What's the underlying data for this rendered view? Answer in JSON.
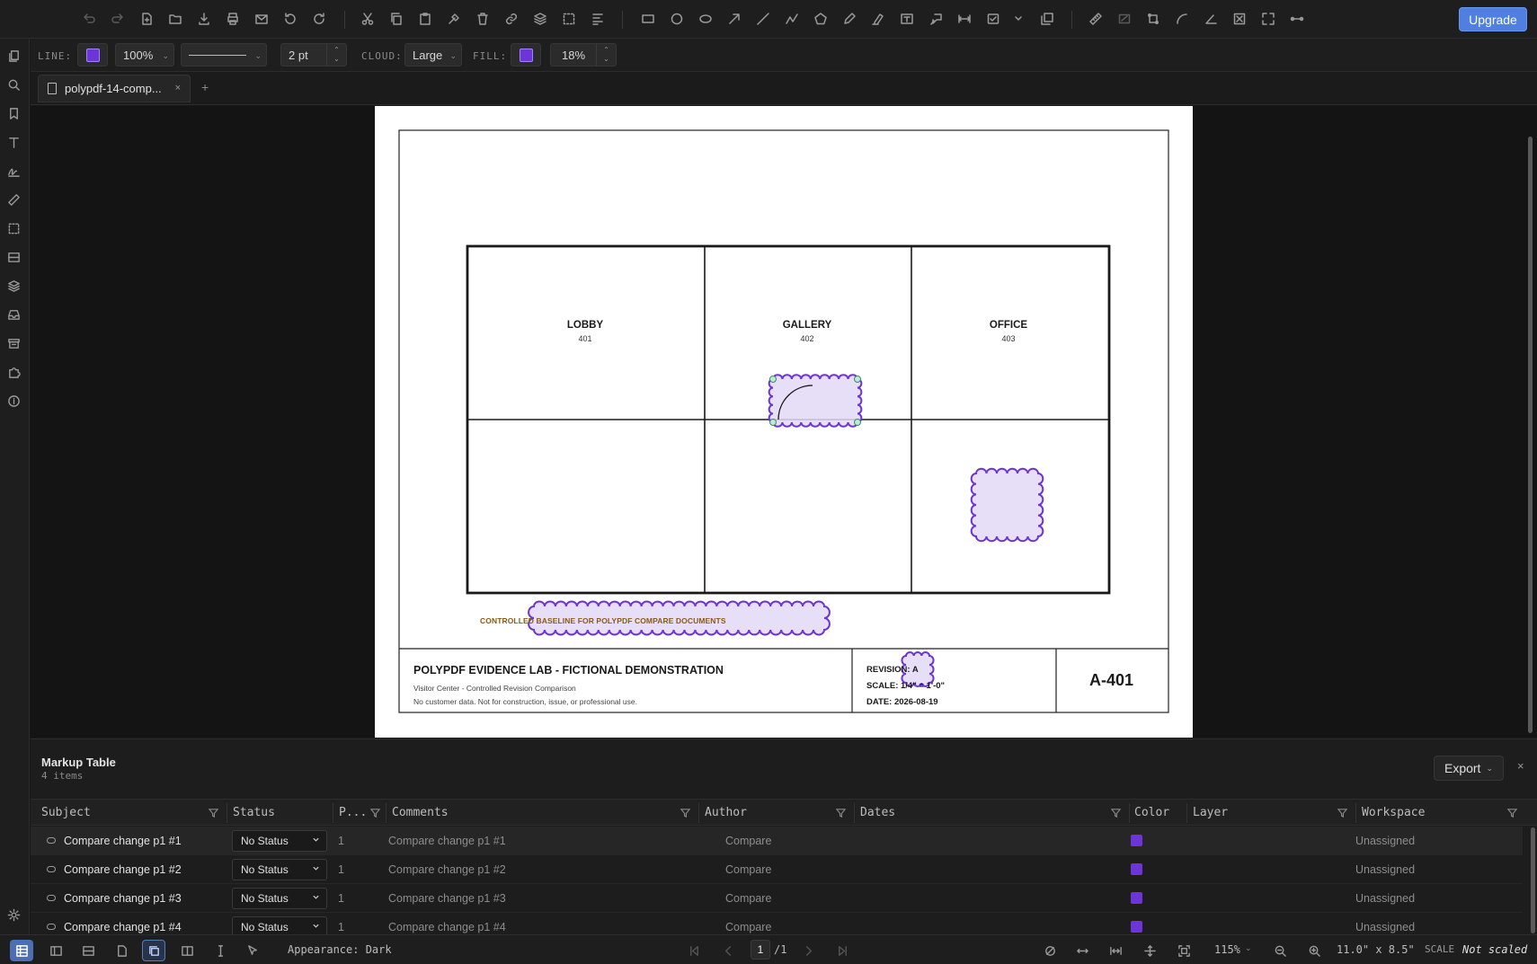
{
  "toolbar": {
    "upgrade_label": "Upgrade"
  },
  "propbar": {
    "line_label": "LINE:",
    "line_color": "#6d35d6",
    "opacity": "100%",
    "stroke_width": "2 pt",
    "cloud_label": "CLOUD:",
    "cloud_size": "Large",
    "fill_label": "FILL:",
    "fill_color": "#6d35d6",
    "fill_opacity": "18%"
  },
  "tabs": {
    "doc_tab_label": "polypdf-14-comp...",
    "close_glyph": "×",
    "add_glyph": "+"
  },
  "drawing": {
    "rooms": [
      {
        "name": "LOBBY",
        "number": "401"
      },
      {
        "name": "GALLERY",
        "number": "402"
      },
      {
        "name": "OFFICE",
        "number": "403"
      }
    ],
    "note": "CONTROLLED BASELINE FOR POLYPDF COMPARE DOCUMENTS",
    "title_block": {
      "title": "POLYPDF EVIDENCE LAB - FICTIONAL DEMONSTRATION",
      "subtitle": "Visitor Center - Controlled Revision Comparison",
      "disclaimer": "No customer data. Not for construction, issue, or professional use.",
      "revision": "REVISION: A",
      "scale": "SCALE: 1/4\" = 1'-0\"",
      "date": "DATE: 2026-08-19",
      "sheet": "A-401"
    },
    "markup_color": "#6d35d6",
    "markup_fill": "#e3d9f7"
  },
  "markup_table": {
    "title": "Markup Table",
    "count": "4 items",
    "export_label": "Export",
    "close_glyph": "×",
    "columns": [
      "Subject",
      "Status",
      "P...",
      "Comments",
      "Author",
      "Dates",
      "Color",
      "Layer",
      "Workspace"
    ],
    "rows": [
      {
        "subject": "Compare change p1 #1",
        "status": "No Status",
        "page": "1",
        "comments": "Compare change p1 #1",
        "author": "Compare",
        "dates": "",
        "color": "#6d35d6",
        "layer": "",
        "workspace": "Unassigned"
      },
      {
        "subject": "Compare change p1 #2",
        "status": "No Status",
        "page": "1",
        "comments": "Compare change p1 #2",
        "author": "Compare",
        "dates": "",
        "color": "#6d35d6",
        "layer": "",
        "workspace": "Unassigned"
      },
      {
        "subject": "Compare change p1 #3",
        "status": "No Status",
        "page": "1",
        "comments": "Compare change p1 #3",
        "author": "Compare",
        "dates": "",
        "color": "#6d35d6",
        "layer": "",
        "workspace": "Unassigned"
      },
      {
        "subject": "Compare change p1 #4",
        "status": "No Status",
        "page": "1",
        "comments": "Compare change p1 #4",
        "author": "Compare",
        "dates": "",
        "color": "#6d35d6",
        "layer": "",
        "workspace": "Unassigned"
      }
    ]
  },
  "statusbar": {
    "appearance": "Appearance: Dark",
    "page_current": "1",
    "page_total": "/1",
    "zoom": "115%",
    "page_size": "11.0\" x 8.5\"",
    "scale_label": "SCALE",
    "scale_value": "Not scaled"
  }
}
